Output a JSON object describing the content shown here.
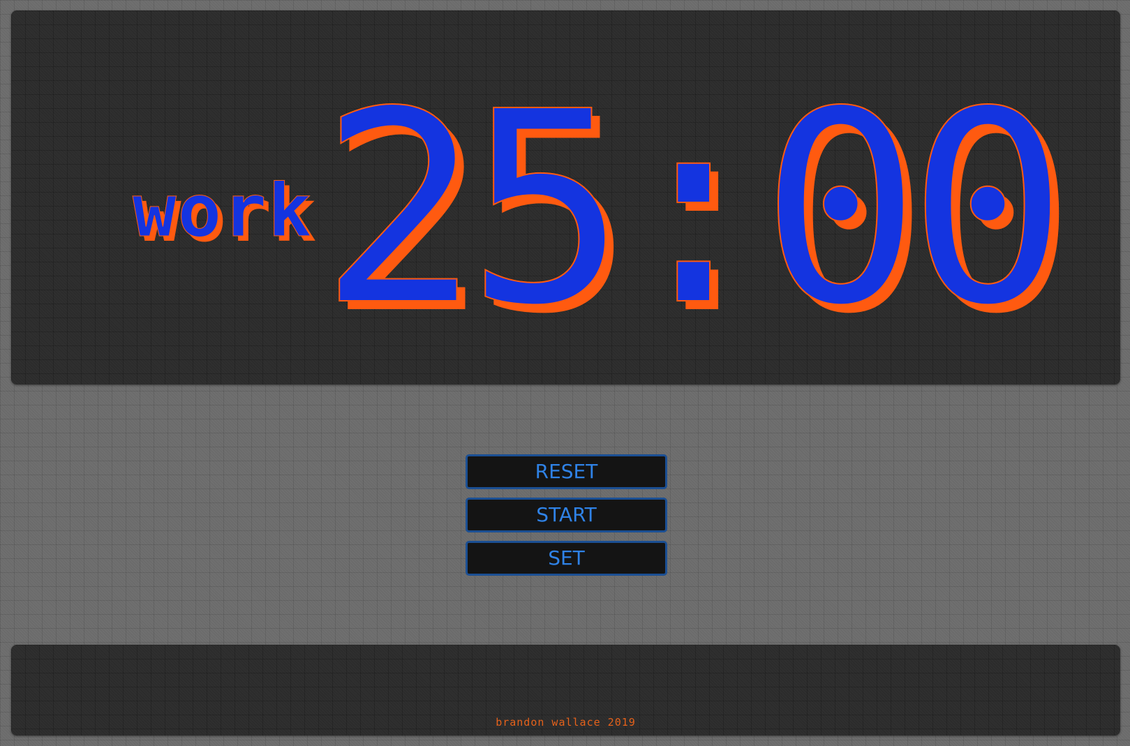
{
  "timer": {
    "mode": "work",
    "time": "25:00"
  },
  "controls": {
    "reset_label": "RESET",
    "start_label": "START",
    "set_label": "SET"
  },
  "footer": {
    "credit": "brandon wallace 2019"
  },
  "colors": {
    "digit_fill": "#1434e0",
    "digit_shadow": "#ff5a10",
    "button_text": "#2f82e6",
    "button_border": "#1b4f93",
    "credit_text": "#e6621b",
    "panel_background": "#2f2f2f",
    "page_background": "#6f6f6f"
  }
}
